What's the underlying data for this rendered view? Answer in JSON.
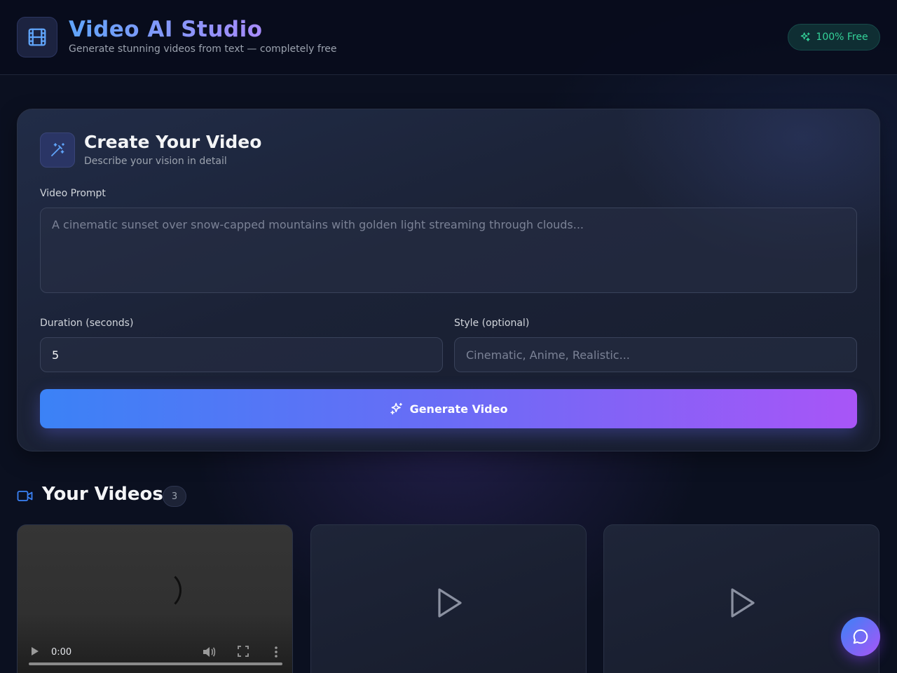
{
  "header": {
    "title": "Video AI Studio",
    "subtitle": "Generate stunning videos from text — completely free",
    "badge": "100% Free",
    "logo_icon": "film-icon"
  },
  "create": {
    "title": "Create Your Video",
    "subtitle": "Describe your vision in detail",
    "icon": "magic-wand-icon",
    "prompt_label": "Video Prompt",
    "prompt_value": "",
    "prompt_placeholder": "A cinematic sunset over snow-capped mountains with golden light streaming through clouds...",
    "duration_label": "Duration (seconds)",
    "duration_value": "5",
    "style_label": "Style (optional)",
    "style_value": "",
    "style_placeholder": "Cinematic, Anime, Realistic...",
    "generate_label": "Generate Video",
    "generate_icon": "sparkles-icon"
  },
  "videos": {
    "title": "Your Videos",
    "count": "3",
    "icon": "video-camera-icon",
    "player_time": "0:00"
  },
  "colors": {
    "background": "#0b1020",
    "accent_blue": "#3b82f6",
    "accent_purple": "#a855f7",
    "badge_green": "#34d399"
  }
}
